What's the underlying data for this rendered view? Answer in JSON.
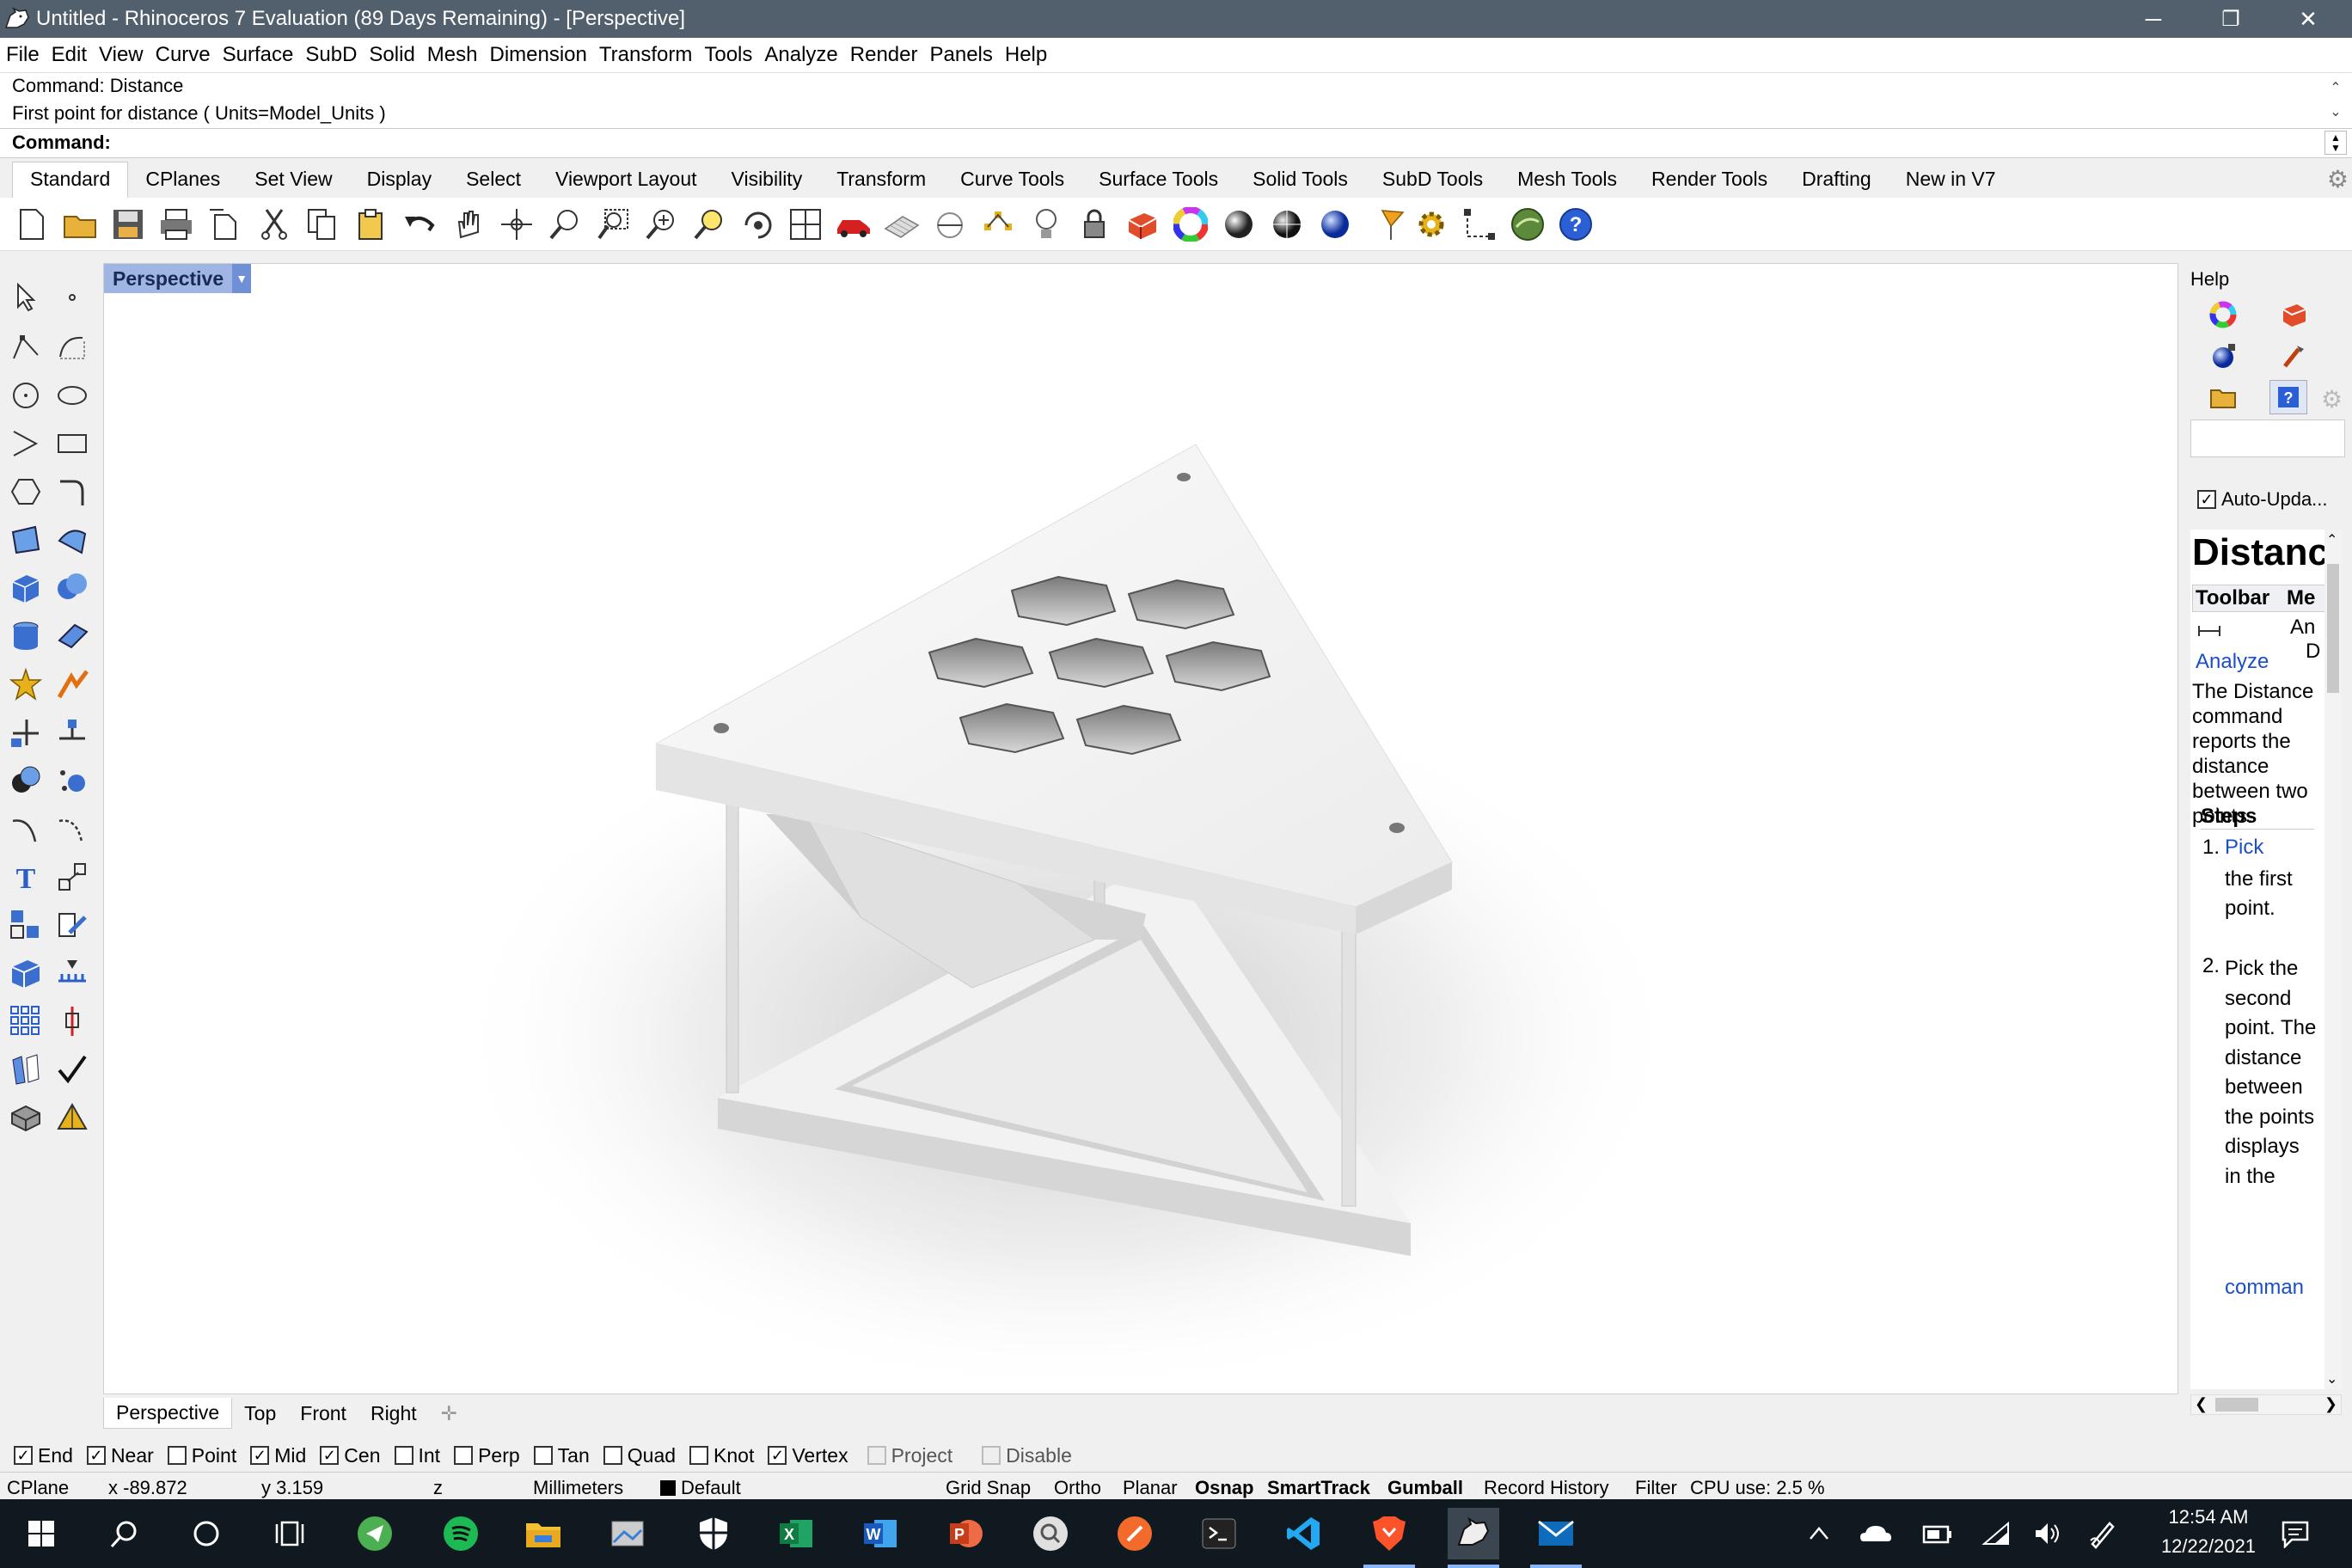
{
  "window": {
    "title": "Untitled - Rhinoceros 7 Evaluation (89 Days Remaining) - [Perspective]",
    "minimize": "─",
    "restore": "❐",
    "close": "✕"
  },
  "menu": [
    "File",
    "Edit",
    "View",
    "Curve",
    "Surface",
    "SubD",
    "Solid",
    "Mesh",
    "Dimension",
    "Transform",
    "Tools",
    "Analyze",
    "Render",
    "Panels",
    "Help"
  ],
  "command": {
    "history": [
      "Command: Distance",
      "First point for distance ( Units=Model_Units )"
    ],
    "prompt_label": "Command:",
    "prompt_value": ""
  },
  "toolbar_tabs": [
    "Standard",
    "CPlanes",
    "Set View",
    "Display",
    "Select",
    "Viewport Layout",
    "Visibility",
    "Transform",
    "Curve Tools",
    "Surface Tools",
    "Solid Tools",
    "SubD Tools",
    "Mesh Tools",
    "Render Tools",
    "Drafting",
    "New in V7"
  ],
  "toolbar_icons": [
    "new-file-icon",
    "open-folder-icon",
    "save-icon",
    "print-icon",
    "import-icon",
    "cut-icon",
    "copy-icon",
    "paste-icon",
    "undo-icon",
    "pan-hand-icon",
    "rotate-view-icon",
    "zoom-icon",
    "zoom-window-icon",
    "zoom-extents-icon",
    "zoom-selected-icon",
    "rotate-camera-icon",
    "four-viewports-icon",
    "car-render-icon",
    "grid-plane-icon",
    "cplane-icon",
    "osnap-icon",
    "light-bulb-icon",
    "lock-icon",
    "material-icon",
    "color-wheel-icon",
    "shaded-sphere-icon",
    "rendered-sphere-icon",
    "blue-sphere-icon",
    "flag-icon",
    "gear-settings-icon",
    "dimension-icon",
    "globe-icon",
    "help-icon"
  ],
  "left_tool_icons": [
    "select-arrow-icon",
    "point-icon",
    "polyline-icon",
    "curve-icon",
    "circle-icon",
    "ellipse-icon",
    "arc-icon",
    "rectangle-icon",
    "polygon-icon",
    "fillet-curve-icon",
    "surface-from-points-icon",
    "surface-tools-icon",
    "box-solid-icon",
    "boolean-union-icon",
    "cylinder-icon",
    "extrude-plane-icon",
    "explode-icon",
    "split-icon",
    "trim-icon",
    "join-icon",
    "boolean-solid-icon",
    "points-cloud-icon",
    "offset-curve-icon",
    "blend-curve-icon",
    "text-icon",
    "move-icon",
    "group-icon",
    "paint-icon",
    "mesh-solid-icon",
    "dimension-tool-icon",
    "array-icon",
    "gumball-move-icon",
    "rebuild-icon",
    "check-icon",
    "render-solid-icon",
    "light-cone-icon"
  ],
  "viewport": {
    "label": "Perspective",
    "tabs": [
      "Perspective",
      "Top",
      "Front",
      "Right"
    ],
    "add_tab": "✛"
  },
  "right_panel": {
    "title": "Help",
    "icons": [
      "color-wheel-panel-icon",
      "material-book-icon",
      "layers-sphere-icon",
      "brush-icon",
      "folder-icon",
      "help-panel-icon",
      "settings-panel-icon"
    ],
    "auto_update_label": "Auto-Upda...",
    "auto_update_checked": true,
    "doc": {
      "heading": "Distance",
      "table_headers": [
        "Toolbar",
        "Me"
      ],
      "table_cells": [
        "An",
        "D"
      ],
      "analyze_link": "Analyze",
      "description": "The Distance command reports the distance between two points.",
      "steps_heading": "Steps",
      "step_1_link": "Pick",
      "step_1_rest": "the first point.",
      "step_2": "Pick the second point. The distance between the points displays in the",
      "step_2_link": "comman"
    }
  },
  "osnaps": [
    {
      "label": "End",
      "checked": true,
      "enabled": true
    },
    {
      "label": "Near",
      "checked": true,
      "enabled": true
    },
    {
      "label": "Point",
      "checked": false,
      "enabled": true
    },
    {
      "label": "Mid",
      "checked": true,
      "enabled": true
    },
    {
      "label": "Cen",
      "checked": true,
      "enabled": true
    },
    {
      "label": "Int",
      "checked": false,
      "enabled": true
    },
    {
      "label": "Perp",
      "checked": false,
      "enabled": true
    },
    {
      "label": "Tan",
      "checked": false,
      "enabled": true
    },
    {
      "label": "Quad",
      "checked": false,
      "enabled": true
    },
    {
      "label": "Knot",
      "checked": false,
      "enabled": true
    },
    {
      "label": "Vertex",
      "checked": true,
      "enabled": true
    },
    {
      "label": "Project",
      "checked": false,
      "enabled": false
    },
    {
      "label": "Disable",
      "checked": false,
      "enabled": false
    }
  ],
  "status": {
    "cplane": "CPlane",
    "x": "x -89.872",
    "y": "y 3.159",
    "z": "z",
    "units": "Millimeters",
    "layer": "Default",
    "layer_color": "#000000",
    "grid_snap": "Grid Snap",
    "ortho": "Ortho",
    "planar": "Planar",
    "osnap": "Osnap",
    "smarttrack": "SmartTrack",
    "gumball": "Gumball",
    "record_history": "Record History",
    "filter": "Filter",
    "cpu": "CPU use: 2.5 %"
  },
  "taskbar": {
    "apps": [
      "windows-start-icon",
      "search-taskbar-icon",
      "cortana-icon",
      "task-view-icon",
      "telegram-icon",
      "spotify-icon",
      "file-explorer-icon",
      "photos-icon",
      "windows-security-icon",
      "excel-icon",
      "word-icon",
      "powerpoint-icon",
      "magnifier-icon",
      "brave-alt-icon",
      "terminal-icon",
      "vscode-icon",
      "brave-icon",
      "rhino-icon",
      "mail-icon"
    ],
    "tray_icons": [
      "chevron-up-icon",
      "onedrive-icon",
      "battery-icon",
      "wifi-icon",
      "volume-icon",
      "pen-icon",
      "notifications-icon"
    ],
    "time": "12:54 AM",
    "date": "12/22/2021"
  },
  "colors": {
    "titlebar": "#52606e",
    "viewport_label_bg": "#9fb5e4",
    "link": "#1a4fc8"
  }
}
